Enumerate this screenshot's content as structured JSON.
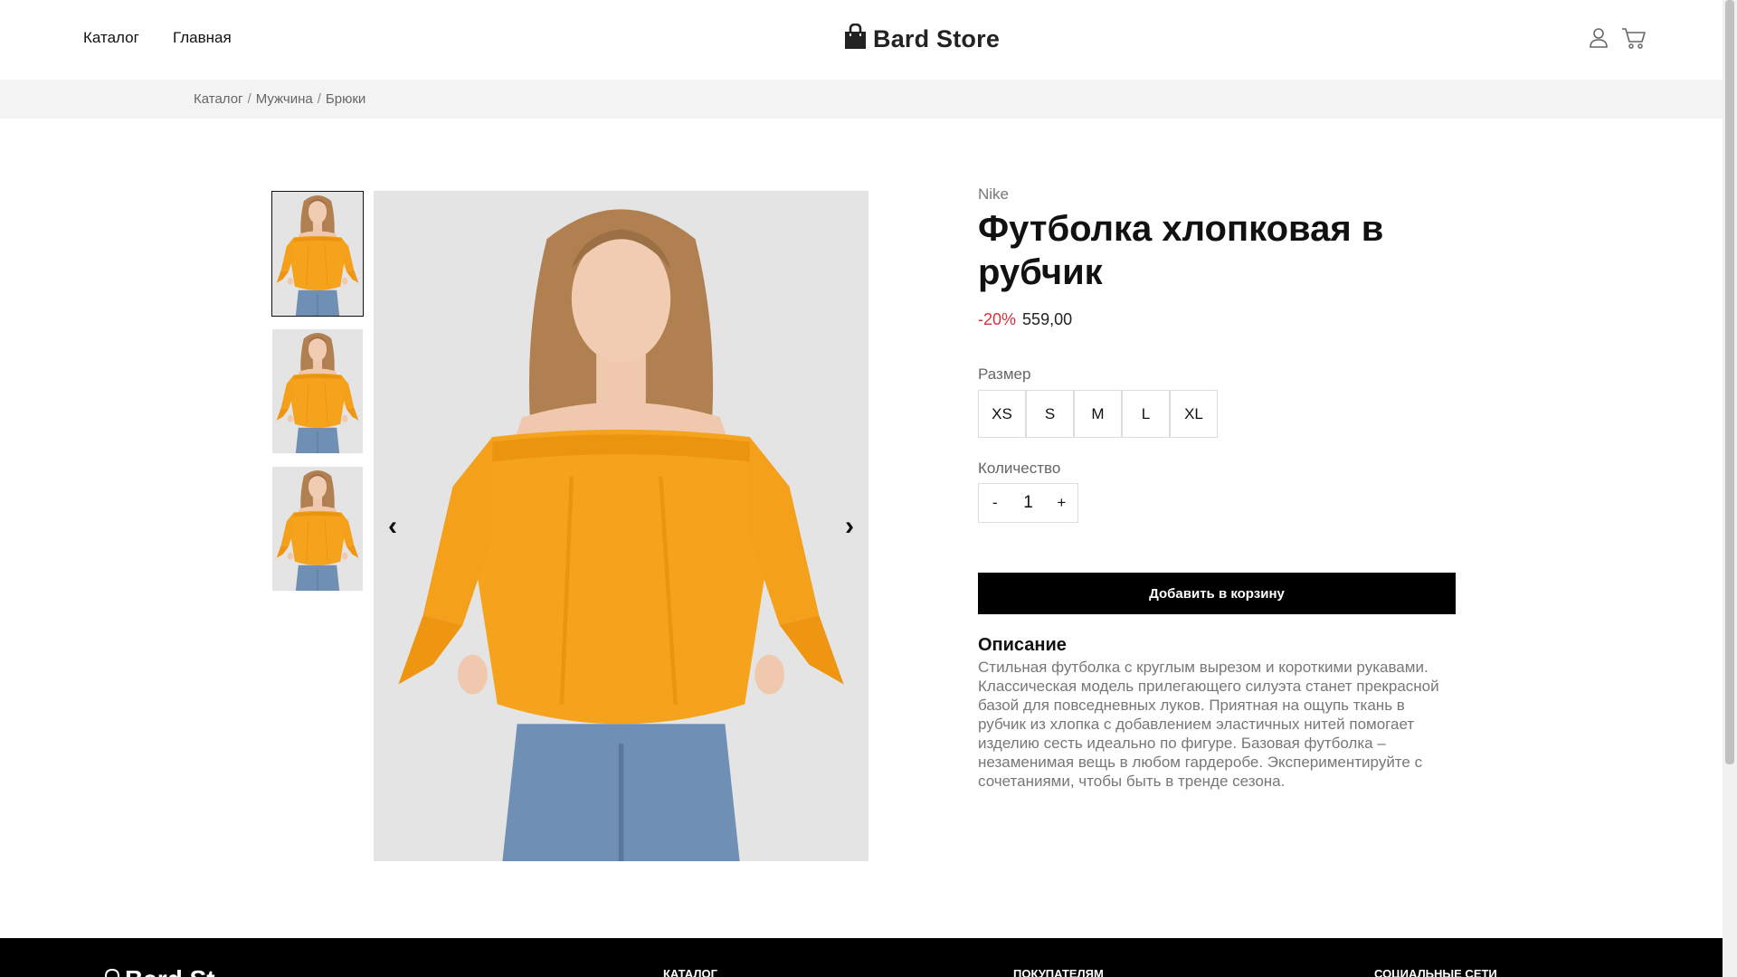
{
  "header": {
    "nav": [
      {
        "label": "Каталог"
      },
      {
        "label": "Главная"
      }
    ],
    "logo_text": "Bard Store",
    "icons": [
      "user-icon",
      "cart-icon"
    ]
  },
  "breadcrumb": [
    "Каталог",
    "Мужчина",
    "Брюки"
  ],
  "breadcrumb_separator": "/",
  "gallery": {
    "thumbnails": [
      "product-photo-1",
      "product-photo-2",
      "product-photo-3"
    ],
    "active_index": 0,
    "prev_arrow": "‹",
    "next_arrow": "›"
  },
  "product": {
    "brand": "Nike",
    "title": "Футболка хлопковая в рубчик",
    "discount": "-20%",
    "price": "559,00",
    "size_label": "Размер",
    "sizes": [
      "XS",
      "S",
      "M",
      "L",
      "XL"
    ],
    "quantity_label": "Количество",
    "qty_minus": "-",
    "qty_plus": "+",
    "quantity": "1",
    "add_to_cart": "Добавить в корзину",
    "description_title": "Описание",
    "description": "Стильная футболка с круглым вырезом и короткими рукавами. Классическая модель прилегающего силуэта станет прекрасной базой для повседневных луков. Приятная на ощупь ткань в рубчик из хлопка с добавлением эластичных нитей помогает изделию сесть идеально по фигуре. Базовая футболка – незаменимая вещь в любом гардеробе. Экспериментируйте с сочетаниями, чтобы быть в тренде сезона."
  },
  "footer": {
    "logo_text": "Bard St",
    "headings": [
      "КАТАЛОГ",
      "ПОКУПАТЕЛЯМ",
      "СОЦИАЛЬНЫЕ СЕТИ"
    ]
  },
  "colors": {
    "accent_discount": "#d6303d",
    "button_bg": "#000000",
    "blouse": "#f5a21c",
    "breadcrumb_bg": "#f3f3f3"
  }
}
